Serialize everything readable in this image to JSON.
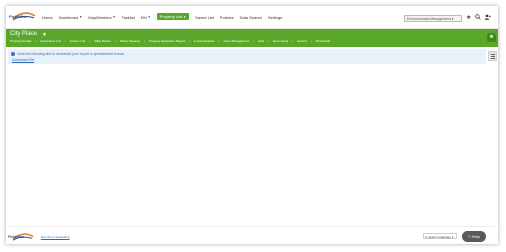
{
  "nav": {
    "logo_text": "FieldWise",
    "items": [
      {
        "label": "Home",
        "has_menu": false
      },
      {
        "label": "Dashboard",
        "has_menu": true
      },
      {
        "label": "Map/Markers",
        "has_menu": true
      },
      {
        "label": "Tasklist",
        "has_menu": false
      },
      {
        "label": "EM",
        "has_menu": true
      },
      {
        "label": "Property List",
        "has_menu": true,
        "active": true
      },
      {
        "label": "Saved List",
        "has_menu": false
      },
      {
        "label": "Policies",
        "has_menu": false
      },
      {
        "label": "Data Search",
        "has_menu": false
      },
      {
        "label": "Settings",
        "has_menu": false
      }
    ],
    "env_selector": "Environmental Management"
  },
  "site": {
    "title": "City Place",
    "subnav": [
      "Property Details",
      "Inspections List",
      "Actions List",
      "Utility Meters",
      "Waste Streams",
      "Property Reduction Targets",
      "F-Gas Register",
      "Asset Management",
      "Jobs",
      "Documents",
      "Hazard",
      "Thresholds"
    ]
  },
  "info": {
    "message": "Click the following link to download your report in spreadsheet format",
    "link": "Download File"
  },
  "footer": {
    "logo_text": "FieldWise",
    "link": "See the ty Scotorship",
    "language": "Select Language",
    "help": "Help"
  },
  "colors": {
    "accent": "#5aa82a",
    "info_bg": "#e8f1fa"
  }
}
